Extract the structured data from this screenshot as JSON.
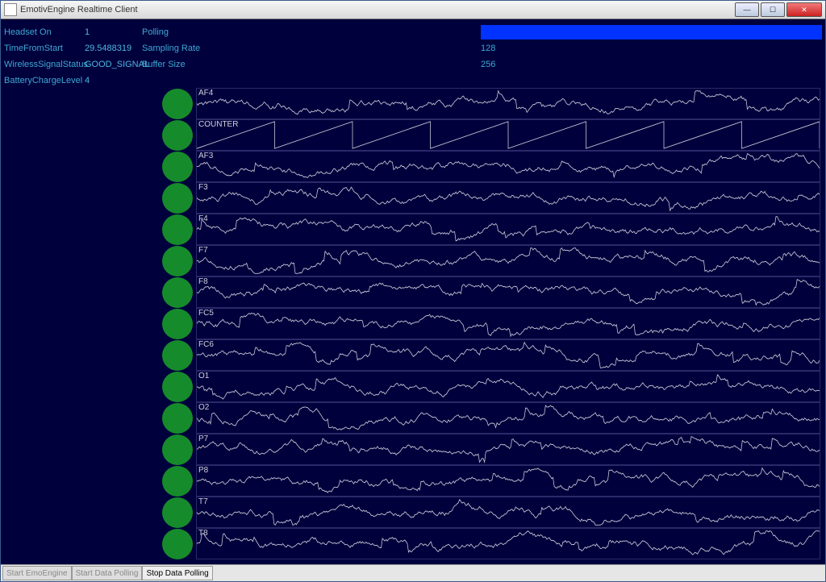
{
  "window": {
    "title": "EmotivEngine Realtime Client"
  },
  "status": {
    "headset_on_label": "Headset On",
    "headset_on_value": "1",
    "time_from_start_label": "TimeFromStart",
    "time_from_start_value": "29.5488319",
    "wireless_label": "WirelessSignalStatus",
    "wireless_value": "GOOD_SIGNAL",
    "battery_label": "BatteryChargeLevel",
    "battery_value": "4"
  },
  "info": {
    "polling_label": "Polling",
    "sampling_label": "Sampling Rate",
    "sampling_value": "128",
    "buffer_label": "Buffer Size",
    "buffer_value": "256"
  },
  "channels": [
    "AF4",
    "COUNTER",
    "AF3",
    "F3",
    "F4",
    "F7",
    "F8",
    "FC5",
    "FC6",
    "O1",
    "O2",
    "P7",
    "P8",
    "T7",
    "T8"
  ],
  "footer": {
    "start_engine": "Start EmoEngine",
    "start_polling": "Start Data Polling",
    "stop_polling": "Stop Data Polling"
  },
  "colors": {
    "bg": "#00003c",
    "text": "#3ea8d4",
    "indicator": "#168b2b",
    "wave": "#c9c9d9",
    "progress": "#0033ff"
  }
}
